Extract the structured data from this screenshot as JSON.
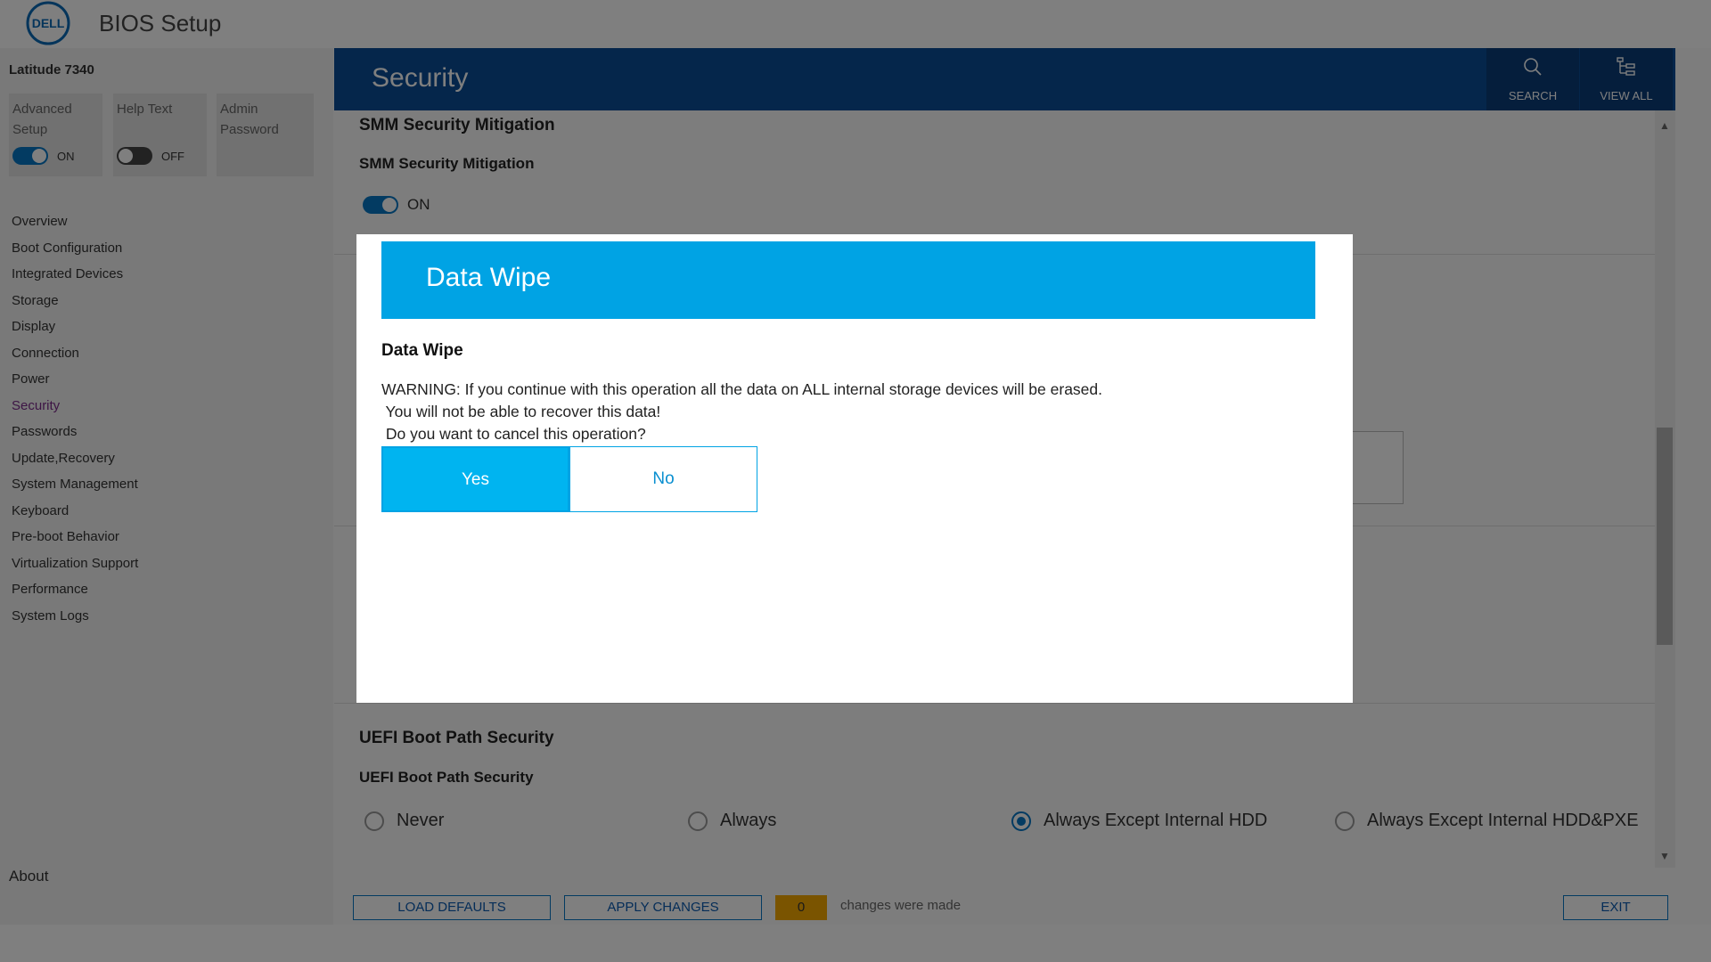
{
  "app": {
    "title": "BIOS Setup",
    "model": "Latitude 7340"
  },
  "quick": [
    {
      "label": "Advanced Setup",
      "state": "ON"
    },
    {
      "label": "Help Text",
      "state": "OFF"
    },
    {
      "label": "Admin Password"
    }
  ],
  "nav": [
    "Overview",
    "Boot Configuration",
    "Integrated Devices",
    "Storage",
    "Display",
    "Connection",
    "Power",
    "Security",
    "Passwords",
    "Update,Recovery",
    "System Management",
    "Keyboard",
    "Pre-boot Behavior",
    "Virtualization Support",
    "Performance",
    "System Logs"
  ],
  "nav_active": "Security",
  "about": "About",
  "header": {
    "title": "Security",
    "search": "SEARCH",
    "view_all": "VIEW ALL"
  },
  "content": {
    "smm_heading": "SMM Security Mitigation",
    "smm_sub": "SMM Security Mitigation",
    "smm_state": "ON",
    "uefi_heading": "UEFI Boot Path Security",
    "uefi_sub": "UEFI Boot Path Security",
    "uefi_options": [
      "Never",
      "Always",
      "Always Except Internal HDD",
      "Always Except Internal HDD&PXE"
    ],
    "uefi_selected": "Always Except Internal HDD"
  },
  "footer": {
    "load_defaults": "LOAD DEFAULTS",
    "apply_changes": "APPLY CHANGES",
    "count": "0",
    "changes_text": "changes were made",
    "exit": "EXIT"
  },
  "modal": {
    "title": "Data Wipe",
    "subtitle": "Data Wipe",
    "line1": "WARNING: If you continue with this operation all the data on ALL internal storage devices will be erased.",
    "line2": " You will not be able to recover this data!",
    "line3": " Do you want to cancel this operation?",
    "yes": "Yes",
    "no": "No"
  },
  "colors": {
    "header": "#0a4d96",
    "modal_header": "#00a3e4",
    "yes_button": "#00b4f0",
    "counter": "#f5a800"
  }
}
